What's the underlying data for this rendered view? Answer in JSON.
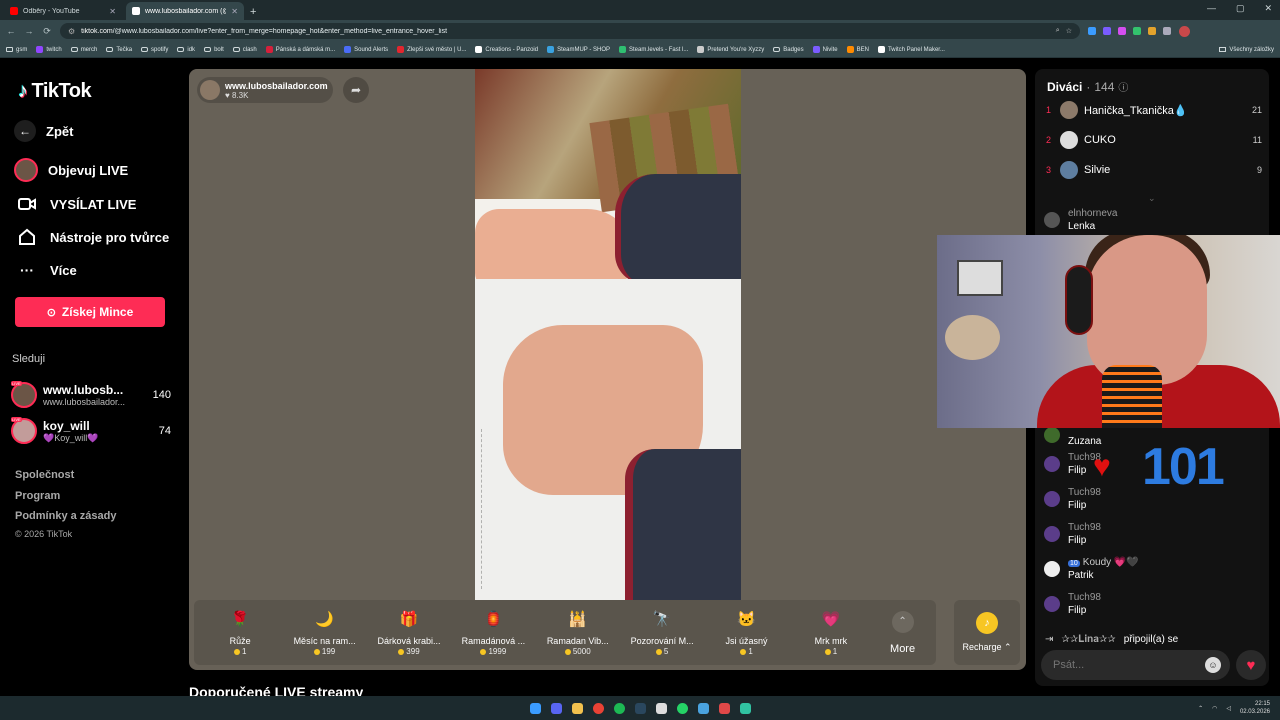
{
  "browser": {
    "tabs": [
      {
        "label": "Odběry - YouTube",
        "active": false,
        "favicon_color": "#ff0000"
      },
      {
        "label": "www.lubosbailador.com (@",
        "active": true,
        "favicon_color": "#ffffff"
      }
    ],
    "url_domain": "tiktok.com",
    "url_path": "/@www.lubosbailador.com/live?enter_from_merge=homepage_hot&enter_method=live_entrance_hover_list",
    "bookmarks": [
      {
        "label": "gsm",
        "folder": true
      },
      {
        "label": "twitch",
        "folder": false,
        "color": "#9146ff"
      },
      {
        "label": "merch",
        "folder": true
      },
      {
        "label": "Tečka",
        "folder": true
      },
      {
        "label": "spotify",
        "folder": true
      },
      {
        "label": "idk",
        "folder": true
      },
      {
        "label": "bolt",
        "folder": true
      },
      {
        "label": "clash",
        "folder": true
      },
      {
        "label": "Pánská a dámská m...",
        "folder": false,
        "color": "#d6203b"
      },
      {
        "label": "Sound Alerts",
        "folder": false,
        "color": "#4a6cf7"
      },
      {
        "label": "Zlepši své město | U...",
        "folder": false,
        "color": "#e3262e"
      },
      {
        "label": "Creations - Panzoid",
        "folder": false,
        "color": "#ffffff"
      },
      {
        "label": "SteamMUP - SHOP",
        "folder": false,
        "color": "#3aa2e0"
      },
      {
        "label": "Steam.levels - Fast l...",
        "folder": false,
        "color": "#2fbf71"
      },
      {
        "label": "Pretend You're Xyzzy",
        "folder": false,
        "color": "#cccccc"
      },
      {
        "label": "Badges",
        "folder": true
      },
      {
        "label": "Nivite",
        "folder": false,
        "color": "#7b5cff"
      },
      {
        "label": "BEN",
        "folder": false,
        "color": "#ff8a00"
      },
      {
        "label": "Twitch Panel Maker...",
        "folder": false,
        "color": "#ffffff"
      }
    ],
    "all_bookmarks_label": "Všechny záložky"
  },
  "sidebar": {
    "logo": "TikTok",
    "back": "Zpět",
    "nav": [
      {
        "label": "Objevuj LIVE"
      },
      {
        "label": "VYSÍLAT LIVE"
      },
      {
        "label": "Nástroje pro tvůrce"
      },
      {
        "label": "Více"
      }
    ],
    "coins_button": "Získej Mince",
    "following_title": "Sleduji",
    "following": [
      {
        "name": "www.lubosb...",
        "sub": "www.lubosbailador...",
        "count": "140",
        "live_badge": "LIVE"
      },
      {
        "name": "koy_will",
        "sub": "💜Koy_will💜",
        "count": "74",
        "live_badge": "LIVE"
      }
    ],
    "footer_links": [
      "Společnost",
      "Program",
      "Podmínky a zásady"
    ],
    "copyright": "© 2026 TikTok"
  },
  "stream": {
    "host_name": "www.lubosbailador.com",
    "host_likes": "8.3K",
    "gifts": [
      {
        "name": "Růže",
        "price": "1",
        "icon": "🌹",
        "color": "#d8203a"
      },
      {
        "name": "Měsíc na ram...",
        "price": "199",
        "icon": "🌙",
        "color": "#6a5acd"
      },
      {
        "name": "Dárková krabi...",
        "price": "399",
        "icon": "🎁",
        "color": "#c49a6c"
      },
      {
        "name": "Ramadánová ...",
        "price": "1999",
        "icon": "🏮",
        "color": "#e0a020"
      },
      {
        "name": "Ramadan Vib...",
        "price": "5000",
        "icon": "🕌",
        "color": "#3a4fb0"
      },
      {
        "name": "Pozorování M...",
        "price": "5",
        "icon": "🔭",
        "color": "#9aa0b5"
      },
      {
        "name": "Jsi úžasný",
        "price": "1",
        "icon": "🐱",
        "color": "#d8a56b"
      },
      {
        "name": "Mrk mrk",
        "price": "1",
        "icon": "💗",
        "color": "#f06aa8"
      }
    ],
    "more_label": "More",
    "recharge_label": "Recharge"
  },
  "recommended_title": "Doporučené LIVE streamy",
  "chat": {
    "viewers_title": "Diváci",
    "viewers_count": "144",
    "top_viewers": [
      {
        "rank": "1",
        "name": "Hanička_Tkanička",
        "score": "21",
        "suffix": "💧"
      },
      {
        "rank": "2",
        "name": "CUKO",
        "score": "11",
        "suffix": ""
      },
      {
        "rank": "3",
        "name": "Silvie",
        "score": "9",
        "suffix": ""
      }
    ],
    "messages": [
      {
        "user": "elnhorneva",
        "text": "Lenka",
        "badge": ""
      },
      {
        "user": "",
        "text": "Zuzana",
        "badge": ""
      },
      {
        "user": "Tuch98",
        "text": "Filip",
        "badge": ""
      },
      {
        "user": "Tuch98",
        "text": "Filip",
        "badge": ""
      },
      {
        "user": "Tuch98",
        "text": "Filip",
        "badge": ""
      },
      {
        "user": "Koudy 💗🖤",
        "text": "Patrik",
        "badge": "10"
      },
      {
        "user": "Tuch98",
        "text": "Filip",
        "badge": ""
      }
    ],
    "joined_user": "✰✰𝐋𝐢𝐧𝐚✰✰",
    "joined_text": "připojil(a) se",
    "input_placeholder": "Psát..."
  },
  "overlay": {
    "counter": "101"
  },
  "taskbar": {
    "time": "22:15",
    "date": "02.03.2026"
  }
}
